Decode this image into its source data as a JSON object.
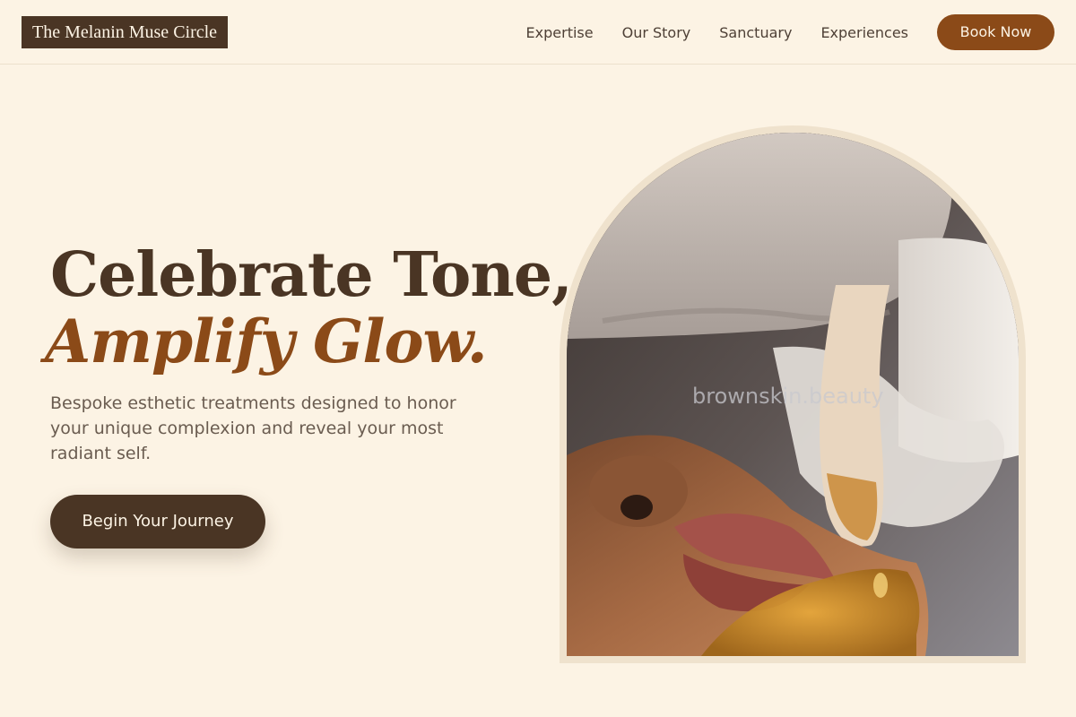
{
  "header": {
    "logo_text": "The Melanin Muse Circle",
    "nav": [
      "Expertise",
      "Our Story",
      "Sanctuary",
      "Experiences"
    ],
    "book_label": "Book Now"
  },
  "hero": {
    "title_line1": "Celebrate Tone,",
    "title_line2": "Amplify Glow.",
    "subtitle": "Bespoke esthetic treatments designed to honor your unique complexion and reveal your most radiant self.",
    "cta_label": "Begin Your Journey"
  },
  "image": {
    "watermark": "brownskin.beauty"
  },
  "colors": {
    "background": "#fcf3e4",
    "dark_brown": "#4a3524",
    "accent_brown": "#8b4a18",
    "arch_frame": "#efe2cd"
  }
}
